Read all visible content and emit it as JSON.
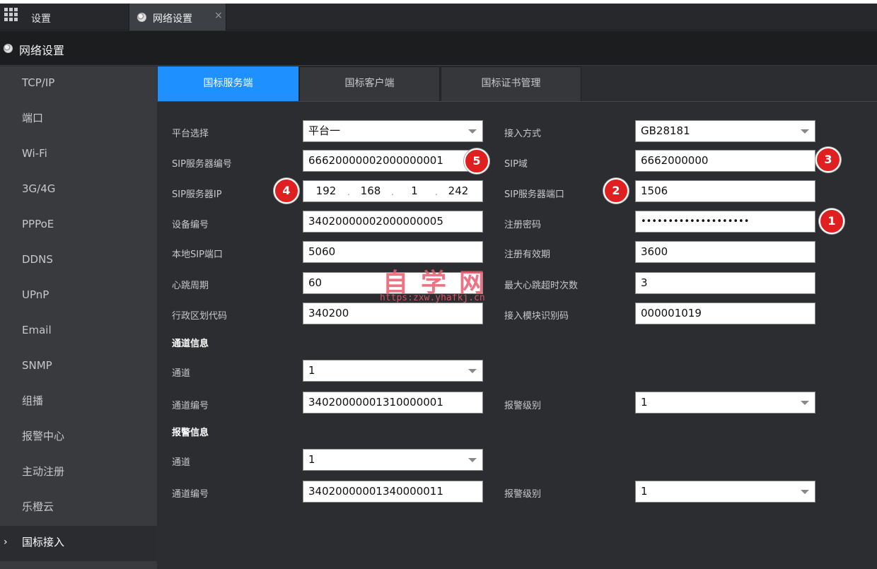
{
  "tabbar": {
    "home_label": "设置",
    "active_tab_label": "网络设置",
    "close_glyph": "×"
  },
  "header": {
    "title": "网络设置"
  },
  "sidebar": {
    "items": [
      "TCP/IP",
      "端口",
      "Wi-Fi",
      "3G/4G",
      "PPPoE",
      "DDNS",
      "UPnP",
      "Email",
      "SNMP",
      "组播",
      "报警中心",
      "主动注册",
      "乐橙云",
      "国标接入"
    ],
    "active_index": 13,
    "chevron": "›"
  },
  "content_tabs": [
    "国标服务端",
    "国标客户端",
    "国标证书管理"
  ],
  "form": {
    "platform_label": "平台选择",
    "platform_value": "平台一",
    "access_mode_label": "接入方式",
    "access_mode_value": "GB28181",
    "sip_server_id_label": "SIP服务器编号",
    "sip_server_id_value": "66620000002000000001",
    "sip_domain_label": "SIP域",
    "sip_domain_value": "6662000000",
    "sip_server_ip_label": "SIP服务器IP",
    "sip_server_ip": [
      "192",
      "168",
      "1",
      "242"
    ],
    "ip_dot": ".",
    "sip_server_port_label": "SIP服务器端口",
    "sip_server_port_value": "1506",
    "device_id_label": "设备编号",
    "device_id_value": "34020000002000000005",
    "register_password_label": "注册密码",
    "register_password_value": "••••••••••••••••••••",
    "local_sip_port_label": "本地SIP端口",
    "local_sip_port_value": "5060",
    "register_validity_label": "注册有效期",
    "register_validity_value": "3600",
    "heartbeat_period_label": "心跳周期",
    "heartbeat_period_value": "60",
    "max_heartbeat_timeout_label": "最大心跳超时次数",
    "max_heartbeat_timeout_value": "3",
    "admin_region_code_label": "行政区划代码",
    "admin_region_code_value": "340200",
    "access_module_id_label": "接入模块识别码",
    "access_module_id_value": "000001019"
  },
  "channel_info": {
    "title": "通道信息",
    "channel_label": "通道",
    "channel_value": "1",
    "channel_id_label": "通道编号",
    "channel_id_value": "34020000001310000001",
    "alarm_level_label": "报警级别",
    "alarm_level_value": "1"
  },
  "alarm_info": {
    "title": "报警信息",
    "channel_label": "通道",
    "channel_value": "1",
    "channel_id_label": "通道编号",
    "channel_id_value": "34020000001340000011",
    "alarm_level_label": "报警级别",
    "alarm_level_value": "1"
  },
  "badges": [
    "1",
    "2",
    "3",
    "4",
    "5"
  ],
  "badge_color": "#e02020",
  "accent_color": "#1e90ff",
  "watermark": {
    "title": "自学网",
    "url": "https:zxw.yhafkj.cn"
  }
}
